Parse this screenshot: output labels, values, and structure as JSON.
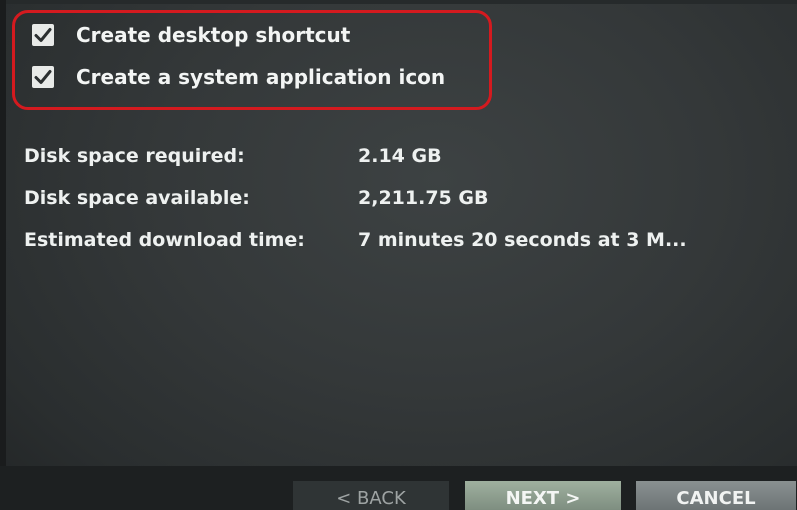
{
  "options": {
    "items": [
      {
        "label": "Create desktop shortcut",
        "checked": true
      },
      {
        "label": "Create a system application icon",
        "checked": true
      }
    ],
    "highlight_color": "#d41a1f"
  },
  "disk_info": {
    "rows": [
      {
        "label": "Disk space required:",
        "value": "2.14 GB"
      },
      {
        "label": "Disk space available:",
        "value": "2,211.75 GB"
      },
      {
        "label": "Estimated download time:",
        "value": "7 minutes 20 seconds at 3 M..."
      }
    ]
  },
  "buttons": {
    "back_label": "< BACK",
    "next_label": "NEXT >",
    "cancel_label": "CANCEL"
  },
  "icons": {
    "checkbox": "checkmark-icon"
  }
}
